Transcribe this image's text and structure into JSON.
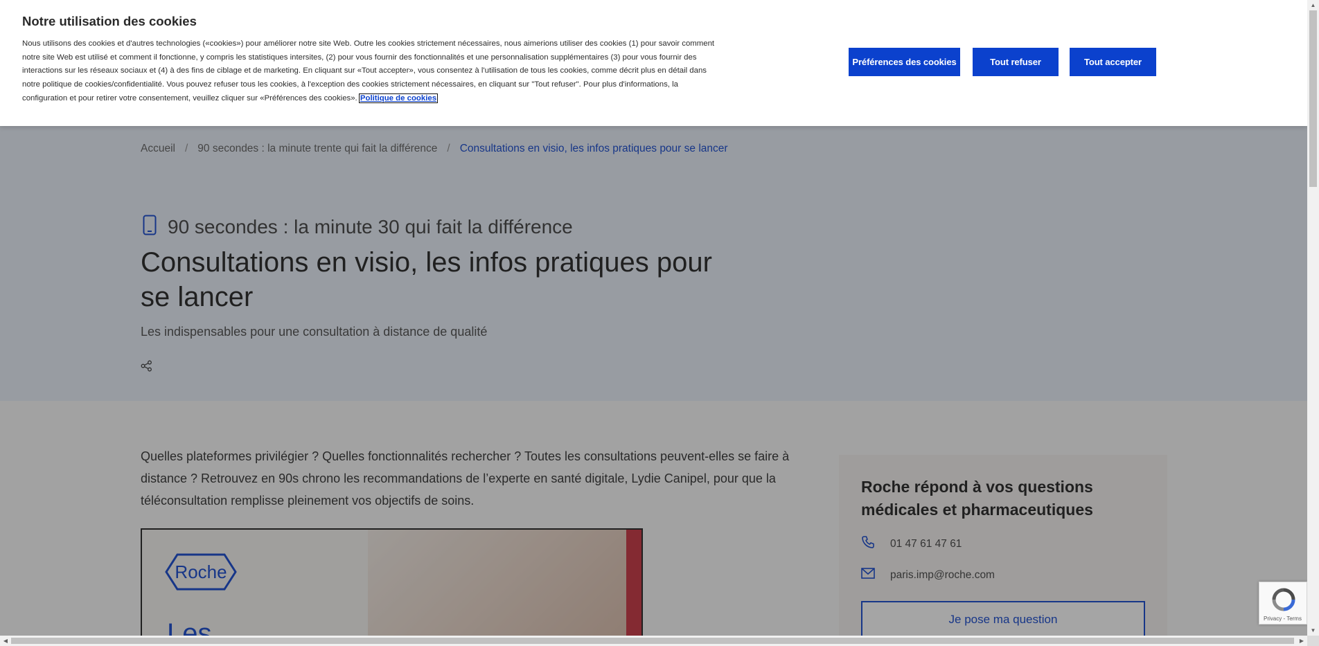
{
  "breadcrumb": {
    "home": "Accueil",
    "section": "90 secondes : la minute trente qui fait la différence",
    "current": "Consultations en visio, les infos pratiques pour se lancer",
    "separator": "/"
  },
  "article": {
    "series_label": "90 secondes : la minute 30 qui fait la différence",
    "title": "Consultations en visio, les infos pratiques pour se lancer",
    "subtitle": "Les indispensables pour une consultation à distance de qualité",
    "intro": "Quelles plateformes privilégier ? Quelles fonctionnalités rechercher ? Toutes les consultations peuvent-elles se faire à distance ? Retrouvez en 90s chrono les recommandations de l’experte en santé digitale, Lydie Canipel, pour que la téléconsultation remplisse pleinement vos objectifs de soins.",
    "promo_logo_text": "Roche",
    "promo_text": "Les"
  },
  "sidebar": {
    "title": "Roche répond à vos questions médicales et pharmaceutiques",
    "phone": "01 47 61 47 61",
    "email": "paris.imp@roche.com",
    "ask_button": "Je pose ma question"
  },
  "cookie_banner": {
    "title": "Notre utilisation des cookies",
    "text": "Nous utilisons des cookies et d'autres technologies («cookies») pour améliorer notre site Web. Outre les cookies strictement nécessaires, nous aimerions utiliser des cookies (1) pour savoir comment notre site Web est utilisé et comment il fonctionne, y compris les statistiques intersites, (2) pour vous fournir des fonctionnalités et une personnalisation supplémentaires (3) pour vous fournir des interactions sur les réseaux sociaux et (4) à des fins de ciblage et de marketing. En cliquant sur «Tout accepter», vous consentez à l'utilisation de tous les cookies, comme décrit plus en détail dans notre politique de cookies/confidentialité. Vous pouvez refuser tous les cookies, à l'exception des cookies strictement nécessaires, en cliquant sur \"Tout refuser\". Pour plus d'informations, la configuration et pour retirer votre consentement, veuillez cliquer sur «Préférences des cookies».",
    "policy_link": "Politique de cookies",
    "buttons": {
      "preferences": "Préférences des cookies",
      "refuse": "Tout refuser",
      "accept": "Tout accepter"
    }
  },
  "recaptcha": {
    "terms": "Privacy - Terms"
  },
  "colors": {
    "brand_blue": "#0b41cd",
    "hero_bg": "#e9f0fa",
    "card_bg": "#f4f2ef"
  },
  "icons": [
    "mobile-phone-icon",
    "share-icon",
    "phone-icon",
    "mail-icon",
    "recaptcha-icon"
  ]
}
